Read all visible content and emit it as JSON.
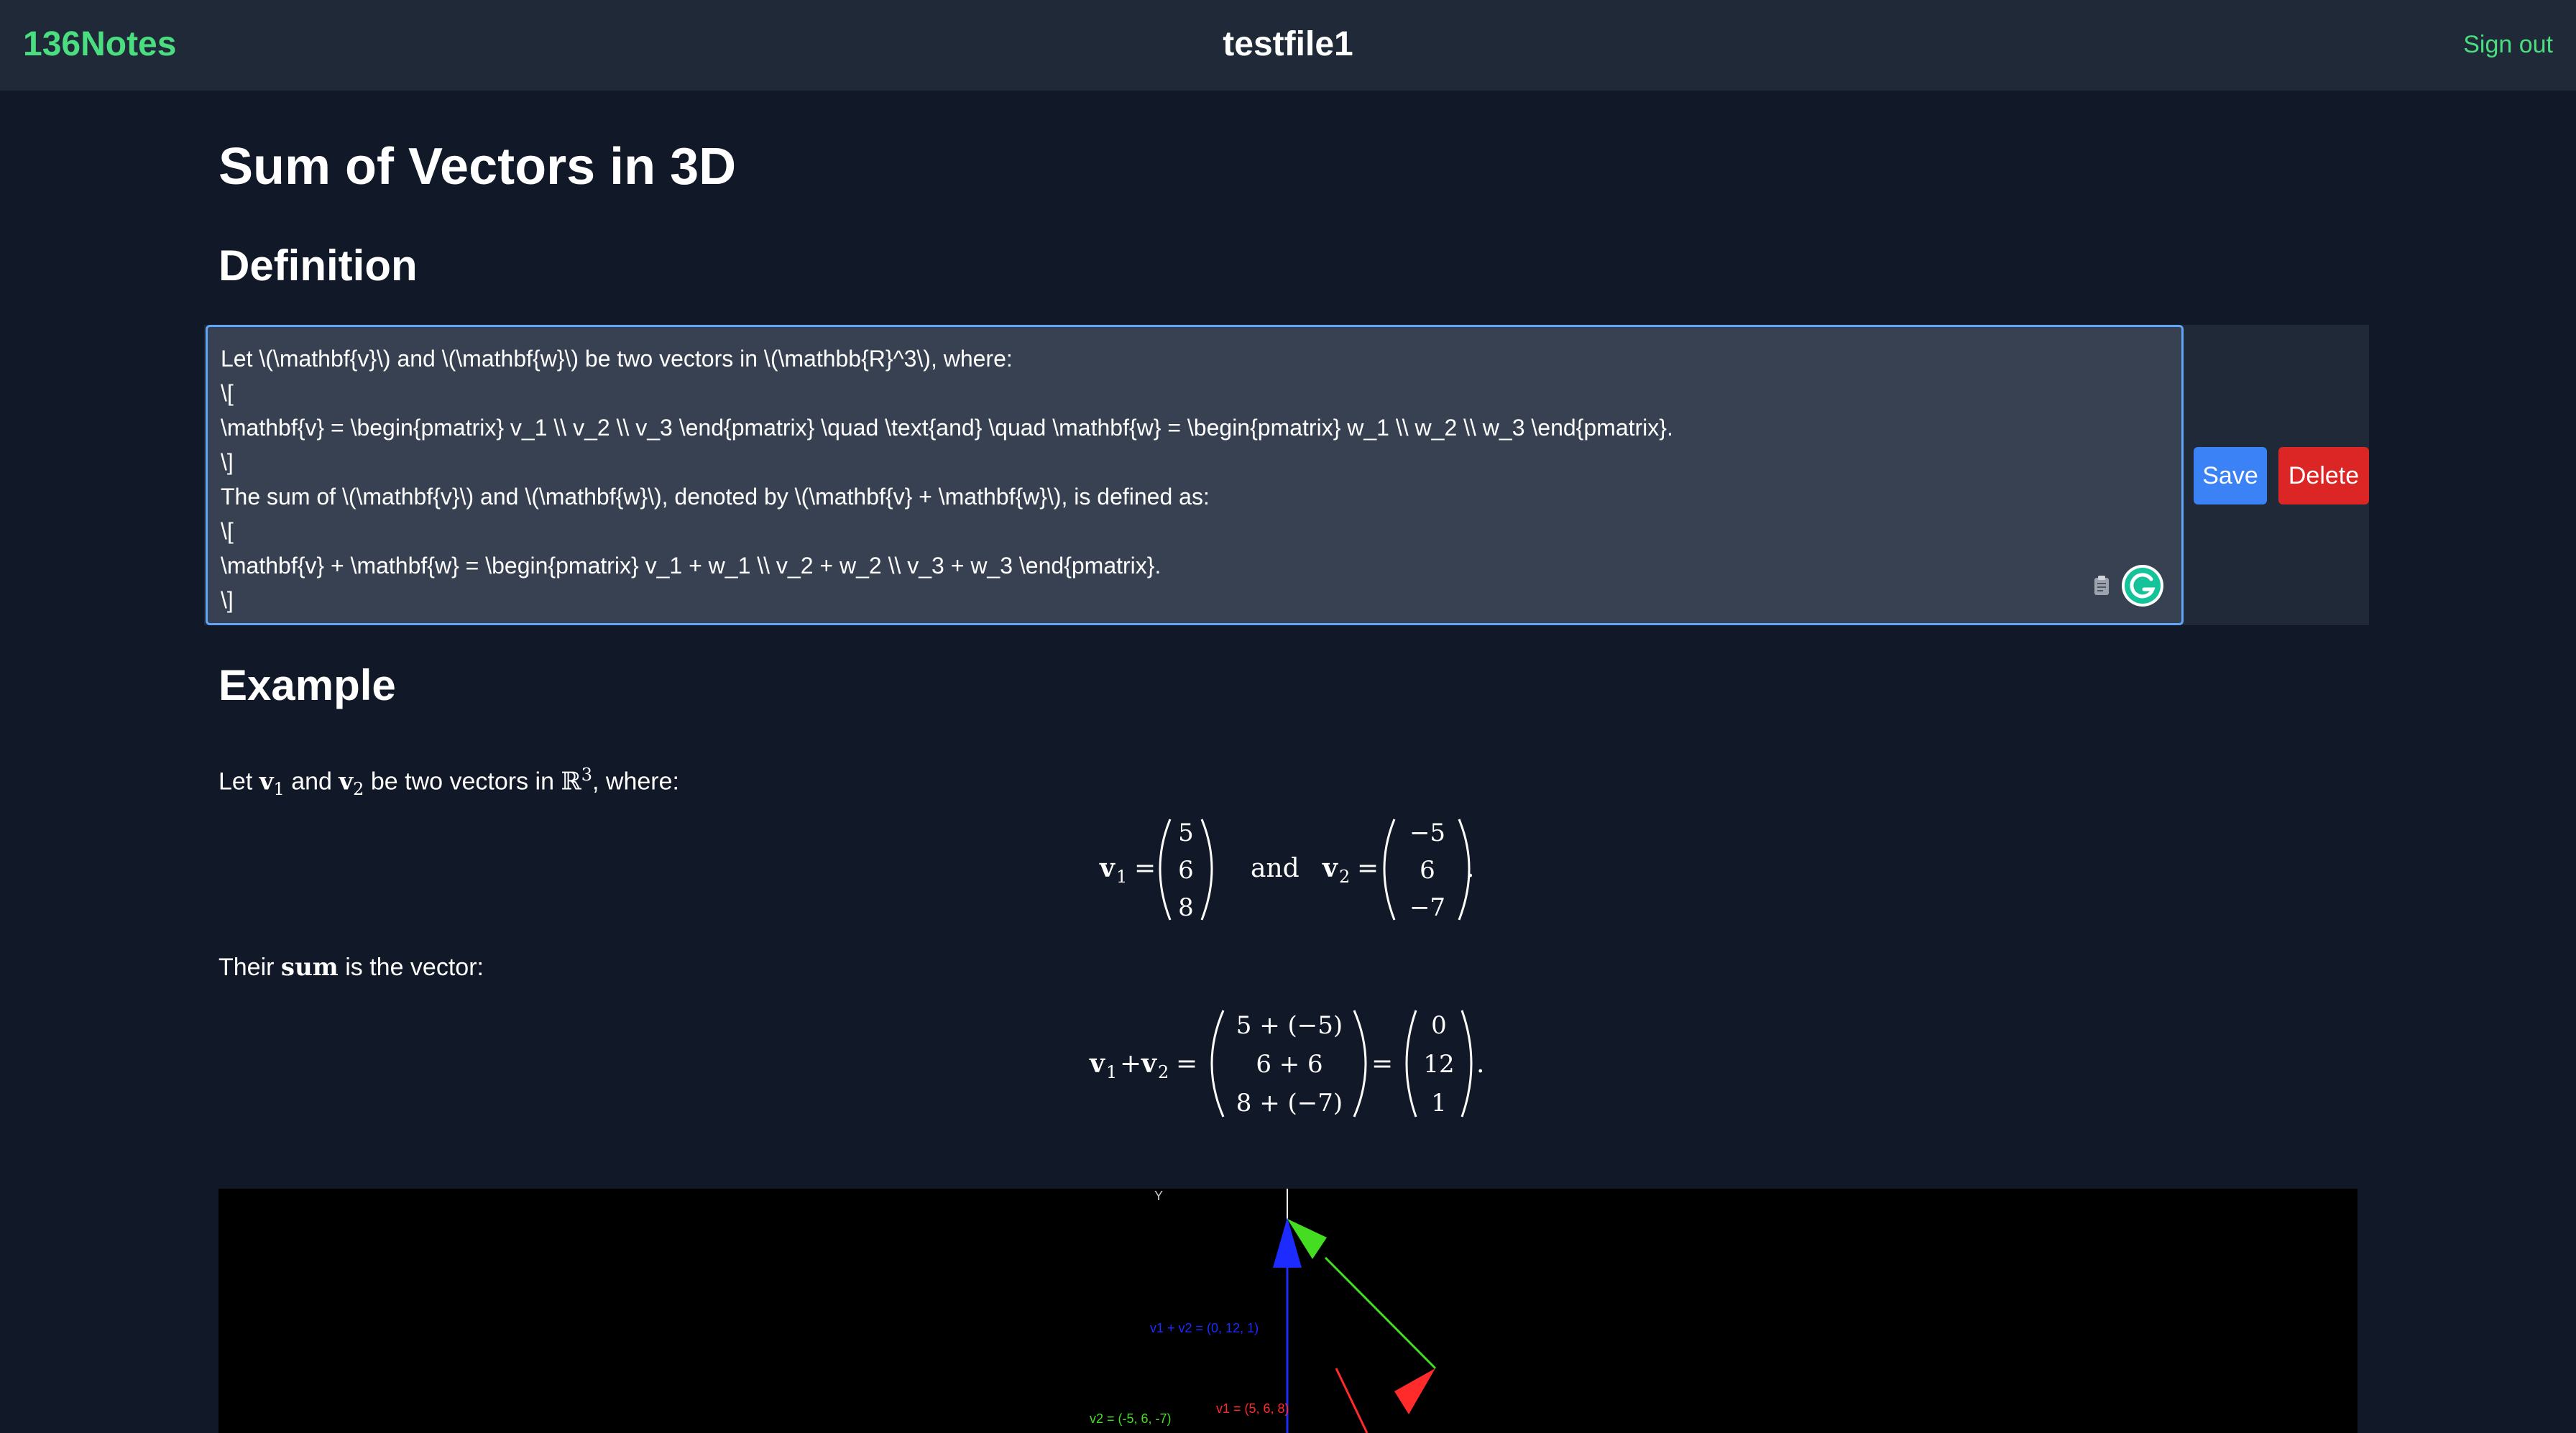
{
  "app": {
    "brand": "136Notes",
    "document_title": "testfile1",
    "sign_out_label": "Sign out"
  },
  "page": {
    "title": "Sum of Vectors in 3D",
    "definition_heading": "Definition",
    "example_heading": "Example"
  },
  "editor": {
    "lines": [
      "Let \\(\\mathbf{v}\\) and \\(\\mathbf{w}\\) be two vectors in \\(\\mathbb{R}^3\\), where:",
      "\\[",
      "\\mathbf{v} = \\begin{pmatrix} v_1 \\\\ v_2 \\\\ v_3 \\end{pmatrix} \\quad \\text{and} \\quad \\mathbf{w} = \\begin{pmatrix} w_1 \\\\ w_2 \\\\ w_3 \\end{pmatrix}.",
      "\\]",
      "The sum of \\(\\mathbf{v}\\) and \\(\\mathbf{w}\\), denoted by \\(\\mathbf{v} + \\mathbf{w}\\), is defined as:",
      "\\[",
      "\\mathbf{v} + \\mathbf{w} = \\begin{pmatrix} v_1 + w_1 \\\\ v_2 + w_2 \\\\ v_3 + w_3 \\end{pmatrix}.",
      "\\]"
    ],
    "save_label": "Save",
    "delete_label": "Delete"
  },
  "example": {
    "intro": {
      "before": "Let ",
      "v1": "v",
      "v1_sub": "1",
      "middle": " and ",
      "v2": "v",
      "v2_sub": "2",
      "after_vectors": " be two vectors in ",
      "field": "ℝ",
      "field_sup": "3",
      "end": ", where:"
    },
    "display1": {
      "v1_lhs": "v",
      "v1_sub": "1",
      "v1_entries": [
        "5",
        "6",
        "8"
      ],
      "and_text": "and",
      "v2_lhs": "v",
      "v2_sub": "2",
      "v2_entries": [
        "−5",
        "6",
        "−7"
      ]
    },
    "sum_sentence": {
      "before": "Their ",
      "bold": "sum",
      "after": " is the vector:"
    },
    "display2": {
      "sum_entries": [
        "5 + (−5)",
        "6 + 6",
        "8 + (−7)"
      ],
      "result_entries": [
        "0",
        "12",
        "1"
      ]
    }
  },
  "visualization": {
    "axis_y_label": "Y",
    "labels": {
      "sum": "v1 + v2 = (0, 12, 1)",
      "v1": "v1 = (5, 6, 8)",
      "v2": "v2 = (-5, 6, -7)"
    },
    "colors": {
      "sum": "#1d2bff",
      "v1": "#ff2a2a",
      "v2": "#44dd22",
      "axis": "#ffffff"
    }
  },
  "theme": {
    "brand_color": "#4ade80",
    "save_color": "#3b82f6",
    "delete_color": "#dc2626",
    "editor_border": "#60a5fa"
  }
}
